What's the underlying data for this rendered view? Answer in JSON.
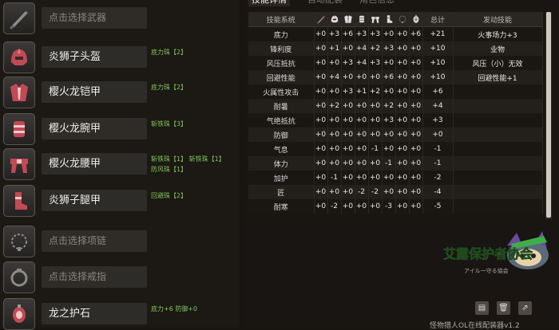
{
  "slots": [
    {
      "name": "点击选择武器",
      "placeholder": true,
      "icon": "weapon-icon",
      "jewels": []
    },
    {
      "name": "炎狮子头盔",
      "placeholder": false,
      "icon": "helmet-icon",
      "jewels": [
        "底力珠【2】"
      ]
    },
    {
      "name": "樱火龙铠甲",
      "placeholder": false,
      "icon": "chest-armor-icon",
      "jewels": [
        "底力珠【2】"
      ]
    },
    {
      "name": "樱火龙腕甲",
      "placeholder": false,
      "icon": "arm-armor-icon",
      "jewels": [
        "斩铁珠【3】"
      ]
    },
    {
      "name": "樱火龙腰甲",
      "placeholder": false,
      "icon": "waist-armor-icon",
      "jewels": [
        "斩铁珠【1】  斩铁珠【1】",
        "防风珠【1】"
      ]
    },
    {
      "name": "炎狮子腿甲",
      "placeholder": false,
      "icon": "leg-armor-icon",
      "jewels": [
        "回避珠【2】"
      ]
    },
    {
      "name": "点击选择项链",
      "placeholder": true,
      "icon": "necklace-icon",
      "jewels": []
    },
    {
      "name": "点击选择戒指",
      "placeholder": true,
      "icon": "ring-icon",
      "jewels": []
    },
    {
      "name": "龙之护石",
      "placeholder": false,
      "icon": "charm-icon",
      "jewels": [
        "底力+6  防御+0"
      ]
    }
  ],
  "tabs": {
    "skills": "技能详情",
    "auto": "自动配装",
    "other": "角色信息"
  },
  "table": {
    "headers": {
      "skill": "技能系统",
      "total": "总计",
      "active": "发动技能"
    },
    "icons": [
      "weapon-icon",
      "helmet-icon",
      "chest-armor-icon",
      "arm-armor-icon",
      "waist-armor-icon",
      "leg-armor-icon",
      "necklace-icon",
      "charm-icon"
    ],
    "rows": [
      {
        "skill": "底力",
        "vals": [
          "+0",
          "+3",
          "+6",
          "+3",
          "+3",
          "+0",
          "+0",
          "+6"
        ],
        "total": "+21",
        "active": "火事场力+3"
      },
      {
        "skill": "锋利度",
        "vals": [
          "+0",
          "+1",
          "+0",
          "+4",
          "+2",
          "+3",
          "+0",
          "+0"
        ],
        "total": "+10",
        "active": "业物"
      },
      {
        "skill": "风压抵抗",
        "vals": [
          "+0",
          "+0",
          "+3",
          "+4",
          "+3",
          "+0",
          "+0",
          "+0"
        ],
        "total": "+10",
        "active": "风压（小）无效"
      },
      {
        "skill": "回避性能",
        "vals": [
          "+0",
          "+4",
          "+0",
          "+0",
          "+0",
          "+6",
          "+0",
          "+0"
        ],
        "total": "+10",
        "active": "回避性能+1"
      },
      {
        "skill": "火属性攻击",
        "vals": [
          "+0",
          "+0",
          "+3",
          "+1",
          "+2",
          "+0",
          "+0",
          "+0"
        ],
        "total": "+6",
        "active": ""
      },
      {
        "skill": "耐暑",
        "vals": [
          "+0",
          "+2",
          "+0",
          "+0",
          "+0",
          "+2",
          "+0",
          "+0"
        ],
        "total": "+4",
        "active": ""
      },
      {
        "skill": "气绝抵抗",
        "vals": [
          "+0",
          "+0",
          "+0",
          "+0",
          "+0",
          "+3",
          "+0",
          "+0"
        ],
        "total": "+3",
        "active": ""
      },
      {
        "skill": "防御",
        "vals": [
          "+0",
          "+0",
          "+0",
          "+0",
          "+0",
          "+0",
          "+0",
          "+0"
        ],
        "total": "+0",
        "active": ""
      },
      {
        "skill": "气息",
        "vals": [
          "+0",
          "+0",
          "+0",
          "+0",
          "-1",
          "+0",
          "+0",
          "+0"
        ],
        "total": "-1",
        "active": ""
      },
      {
        "skill": "体力",
        "vals": [
          "+0",
          "+0",
          "+0",
          "+0",
          "+0",
          "-1",
          "+0",
          "+0"
        ],
        "total": "-1",
        "active": ""
      },
      {
        "skill": "加护",
        "vals": [
          "+0",
          "-1",
          "+0",
          "+0",
          "+0",
          "+0",
          "+0",
          "+0"
        ],
        "total": "-2",
        "active": ""
      },
      {
        "skill": "匠",
        "vals": [
          "+0",
          "+0",
          "+0",
          "-2",
          "-2",
          "+0",
          "+0",
          "+0"
        ],
        "total": "-4",
        "active": ""
      },
      {
        "skill": "耐寒",
        "vals": [
          "+0",
          "-2",
          "+0",
          "+0",
          "+0",
          "-3",
          "+0",
          "+0"
        ],
        "total": "-5",
        "active": ""
      }
    ]
  },
  "logo": {
    "text": "艾露保护者协会",
    "sub": "アイルー守る協会",
    "icon": "cat-mascot-icon"
  },
  "buttons": [
    {
      "icon": "save-icon"
    },
    {
      "icon": "delete-icon"
    },
    {
      "icon": "share-icon"
    }
  ],
  "footer": "怪物猎人OL在线配装器v1.2",
  "colors": {
    "jewel": "#7fc85a",
    "accent": "#3fae4a"
  }
}
